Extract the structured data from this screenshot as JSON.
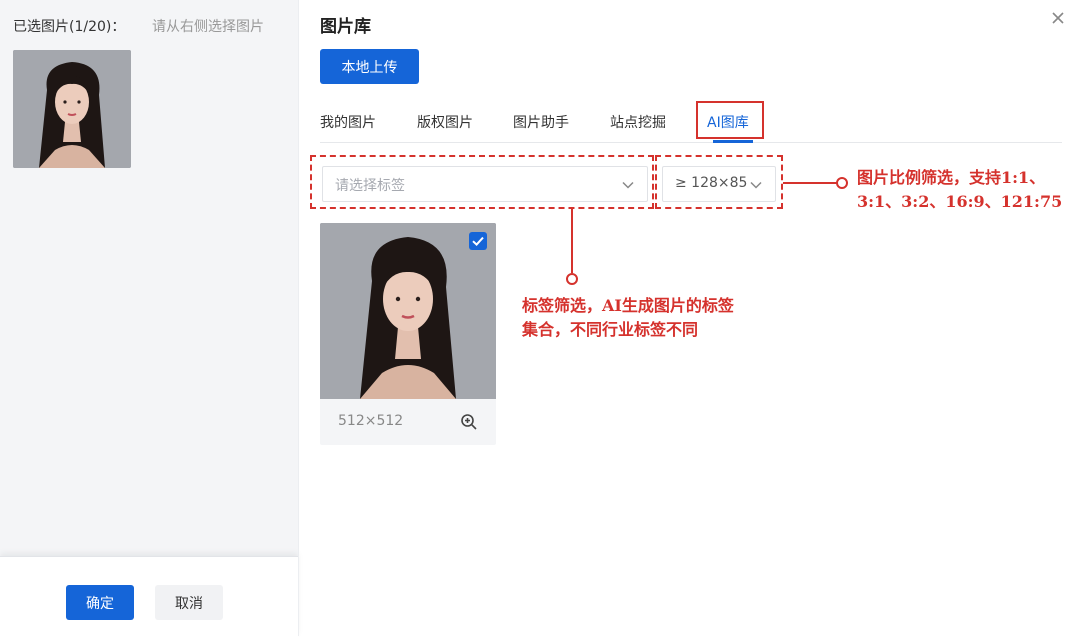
{
  "left": {
    "selected_label": "已选图片(1/20)：",
    "hint": "请从右侧选择图片",
    "confirm_label": "确定",
    "cancel_label": "取消"
  },
  "dialog": {
    "title": "图片库",
    "upload_label": "本地上传",
    "tabs": [
      {
        "label": "我的图片"
      },
      {
        "label": "版权图片"
      },
      {
        "label": "图片助手"
      },
      {
        "label": "站点挖掘"
      },
      {
        "label": "AI图库",
        "active": true
      }
    ]
  },
  "filters": {
    "tag_placeholder": "请选择标签",
    "ratio_value": "≥ 128×85"
  },
  "images": [
    {
      "size": "512×512",
      "selected": true
    }
  ],
  "annotations": {
    "ratio_note_line1": "图片比例筛选，支持1:1、",
    "ratio_note_line2": "3:1、3:2、16:9、121:75",
    "tag_note_line1": "标签筛选，AI生成图片的标签",
    "tag_note_line2": "集合，不同行业标签不同"
  },
  "colors": {
    "accent": "#1565d8",
    "annotation": "#d5322d",
    "left_panel_bg": "#f4f5f7"
  }
}
